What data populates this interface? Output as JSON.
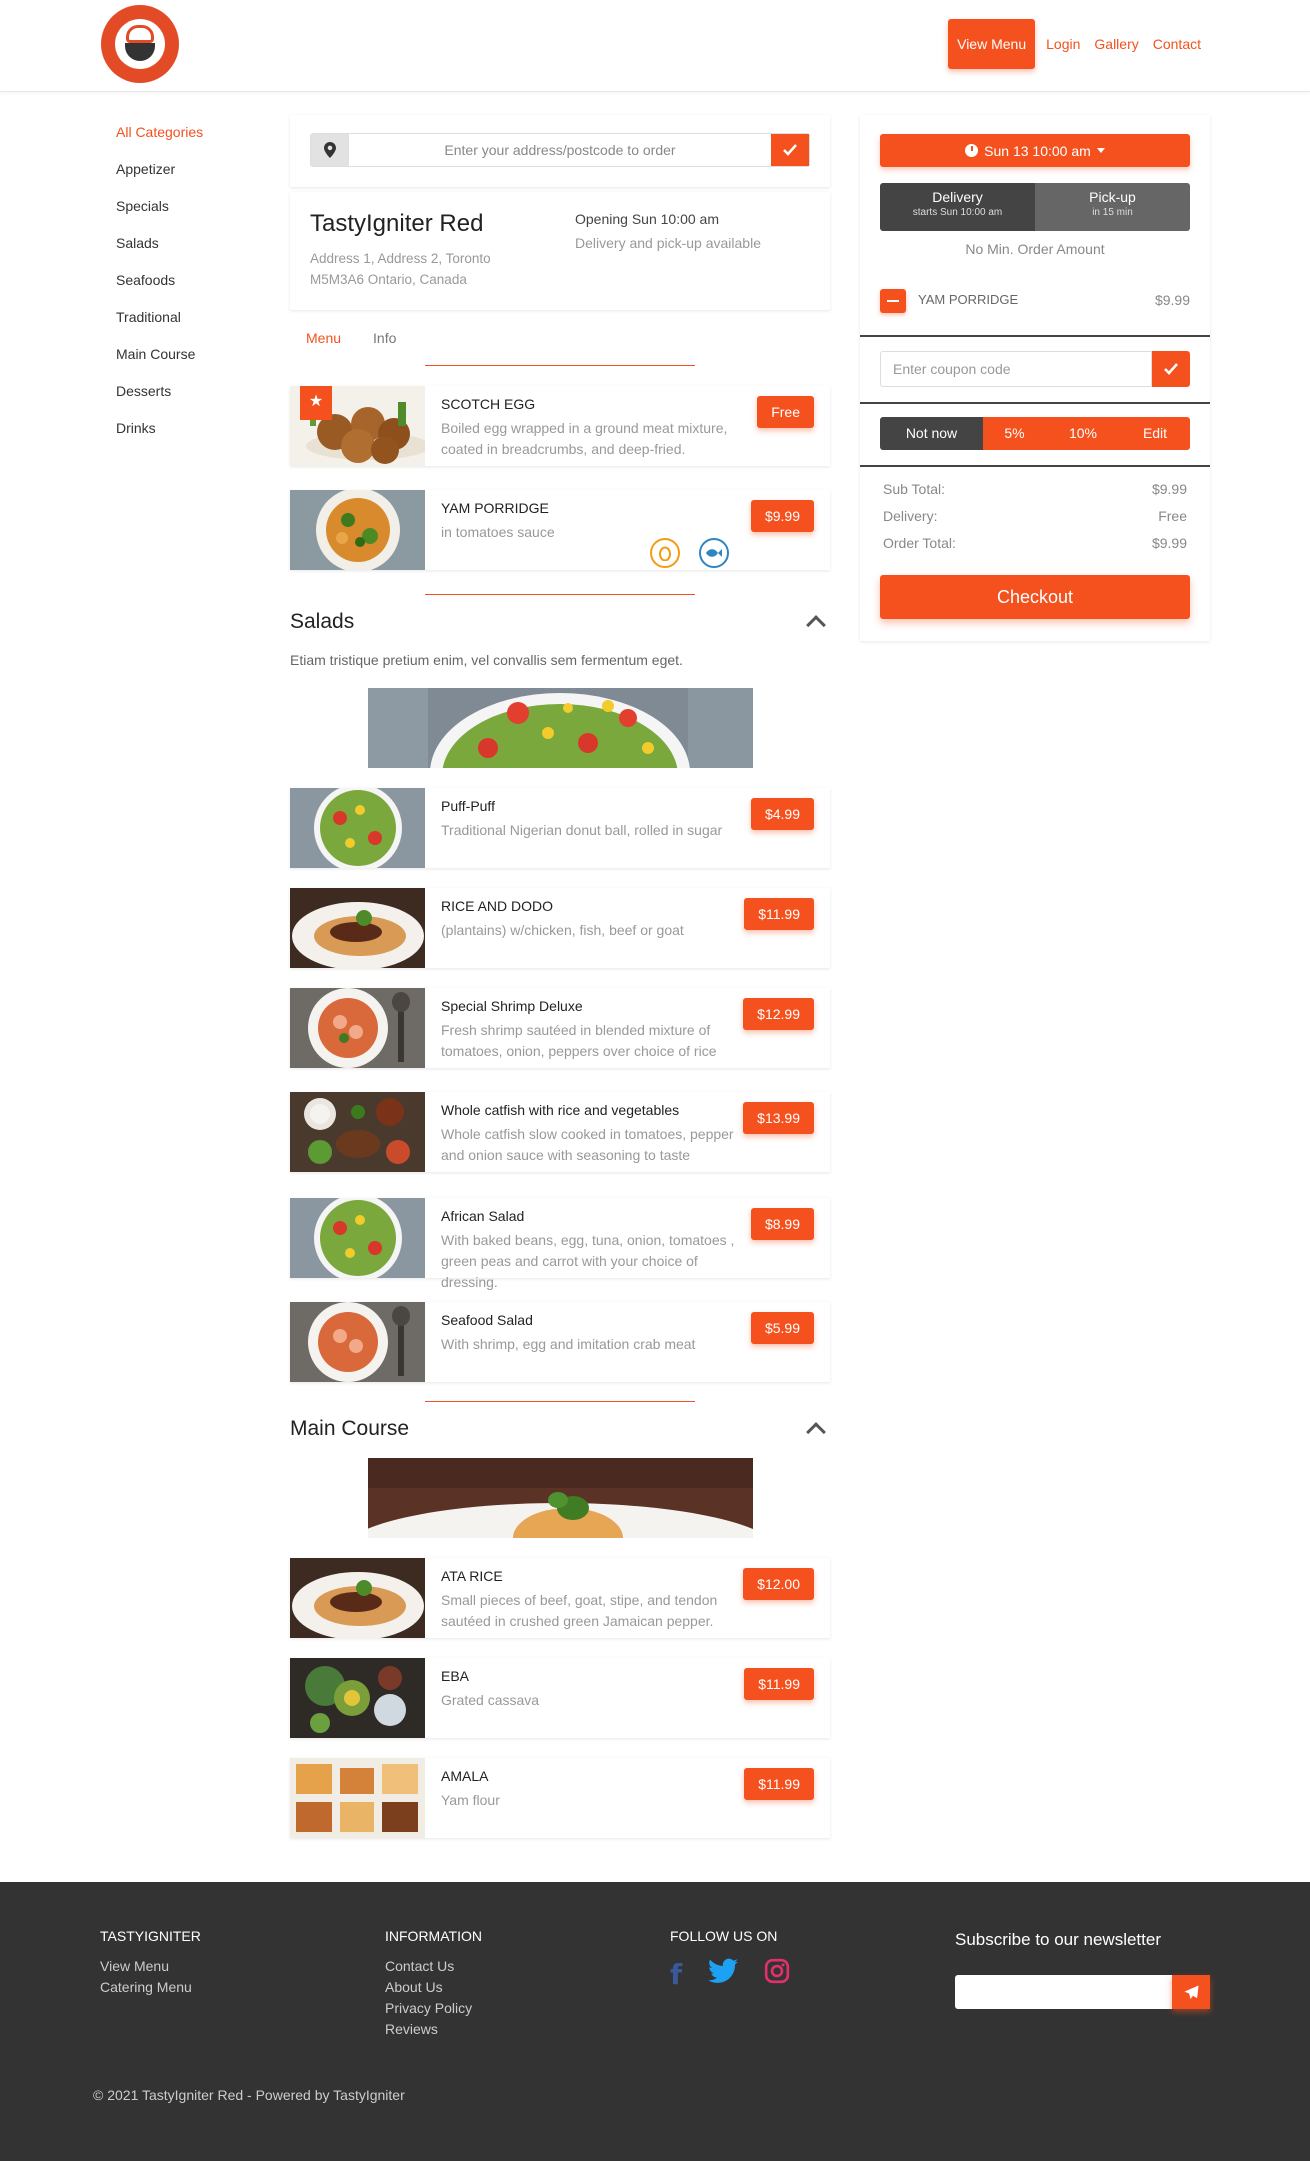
{
  "header": {
    "nav": {
      "view_menu": "View Menu",
      "login": "Login",
      "gallery": "Gallery",
      "contact": "Contact"
    }
  },
  "categories": [
    {
      "label": "All Categories",
      "active": true
    },
    {
      "label": "Appetizer"
    },
    {
      "label": "Specials"
    },
    {
      "label": "Salads"
    },
    {
      "label": "Seafoods"
    },
    {
      "label": "Traditional"
    },
    {
      "label": "Main Course"
    },
    {
      "label": "Desserts"
    },
    {
      "label": "Drinks"
    }
  ],
  "search": {
    "placeholder": "Enter your address/postcode to order"
  },
  "restaurant": {
    "name": "TastyIgniter Red",
    "address_line1": "Address 1, Address 2, Toronto",
    "address_line2": "M5M3A6 Ontario, Canada",
    "opening": "Opening Sun 10:00 am",
    "availability": "Delivery and pick-up available"
  },
  "tabs": {
    "menu": "Menu",
    "info": "Info"
  },
  "items_top": [
    {
      "name": "SCOTCH EGG",
      "desc": "Boiled egg wrapped in a ground meat mixture, coated in breadcrumbs, and deep-fried.",
      "price": "Free"
    },
    {
      "name": "YAM PORRIDGE",
      "desc": "in tomatoes sauce",
      "price": "$9.99"
    }
  ],
  "salads": {
    "title": "Salads",
    "desc": "Etiam tristique pretium enim, vel convallis sem fermentum eget.",
    "items": [
      {
        "name": "Puff-Puff",
        "desc": "Traditional Nigerian donut ball, rolled in sugar",
        "price": "$4.99"
      },
      {
        "name": "RICE AND DODO",
        "desc": "(plantains) w/chicken, fish, beef or goat",
        "price": "$11.99"
      },
      {
        "name": "Special Shrimp Deluxe",
        "desc": "Fresh shrimp sautéed in blended mixture of tomatoes, onion, peppers over choice of rice",
        "price": "$12.99"
      },
      {
        "name": "Whole catfish with rice and vegetables",
        "desc": "Whole catfish slow cooked in tomatoes, pepper and onion sauce with seasoning to taste",
        "price": "$13.99"
      },
      {
        "name": "African Salad",
        "desc": "With baked beans, egg, tuna, onion, tomatoes , green peas and carrot with your choice of dressing.",
        "price": "$8.99"
      },
      {
        "name": "Seafood Salad",
        "desc": "With shrimp, egg and imitation crab meat",
        "price": "$5.99"
      }
    ]
  },
  "main_course": {
    "title": "Main Course",
    "items": [
      {
        "name": "ATA RICE",
        "desc": "Small pieces of beef, goat, stipe, and tendon sautéed in crushed green Jamaican pepper.",
        "price": "$12.00"
      },
      {
        "name": "EBA",
        "desc": "Grated cassava",
        "price": "$11.99"
      },
      {
        "name": "AMALA",
        "desc": "Yam flour",
        "price": "$11.99"
      }
    ]
  },
  "cart": {
    "time": "Sun 13 10:00 am",
    "delivery_label": "Delivery",
    "delivery_sub": "starts Sun 10:00 am",
    "pickup_label": "Pick-up",
    "pickup_sub": "in 15 min",
    "min_order": "No Min. Order Amount",
    "item_name": "YAM PORRIDGE",
    "item_price": "$9.99",
    "coupon_placeholder": "Enter coupon code",
    "tips": [
      "Not now",
      "5%",
      "10%",
      "Edit"
    ],
    "subtotal_label": "Sub Total:",
    "subtotal": "$9.99",
    "delivery_fee_label": "Delivery:",
    "delivery_fee": "Free",
    "total_label": "Order Total:",
    "total": "$9.99",
    "checkout": "Checkout"
  },
  "footer": {
    "col1_title": "TASTYIGNITER",
    "col1_links": [
      "View Menu",
      "Catering Menu"
    ],
    "col2_title": "INFORMATION",
    "col2_links": [
      "Contact Us",
      "About Us",
      "Privacy Policy",
      "Reviews"
    ],
    "col3_title": "FOLLOW US ON",
    "newsletter_title": "Subscribe to our newsletter",
    "copyright": "© 2021 TastyIgniter Red - Powered by TastyIgniter"
  },
  "colors": {
    "accent": "#f4511e",
    "footer_bg": "#333333",
    "dark_button": "#444444"
  },
  "icons": [
    "map-pin-icon",
    "check-icon",
    "star-icon",
    "chevron-up-icon",
    "clock-icon",
    "caret-down-icon",
    "minus-icon",
    "facebook-icon",
    "twitter-icon",
    "instagram-icon",
    "send-icon",
    "egg-allergen-icon",
    "fish-allergen-icon"
  ]
}
